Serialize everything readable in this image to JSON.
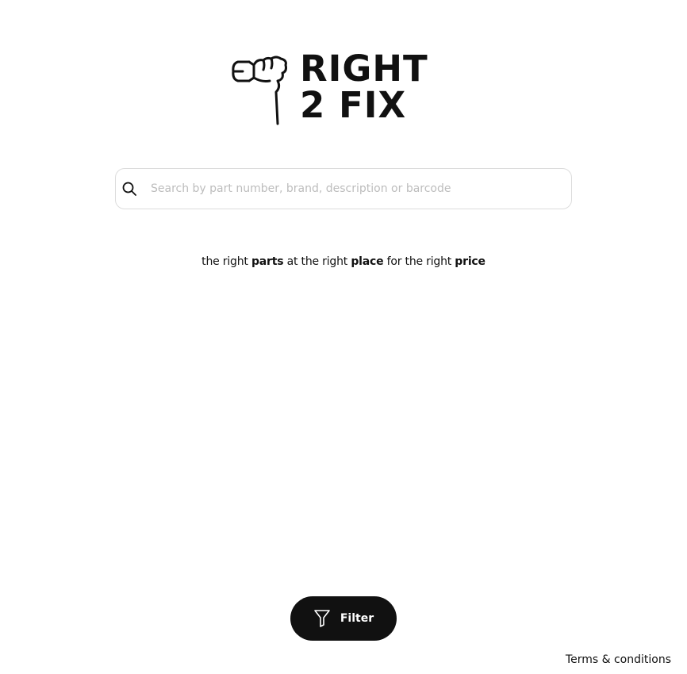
{
  "logo": {
    "line1": "RIGHT",
    "line2": "2 FIX",
    "mark_icon": "wrench-hand-icon"
  },
  "search": {
    "placeholder": "Search by part number, brand, description or barcode",
    "value": "",
    "icon": "search-icon"
  },
  "tagline": {
    "segments": [
      {
        "text": "the right ",
        "bold": false
      },
      {
        "text": "parts",
        "bold": true
      },
      {
        "text": " at the right ",
        "bold": false
      },
      {
        "text": "place",
        "bold": true
      },
      {
        "text": " for the right ",
        "bold": false
      },
      {
        "text": "price",
        "bold": true
      }
    ]
  },
  "filter_button": {
    "label": "Filter",
    "icon": "funnel-icon"
  },
  "footer": {
    "terms_label": "Terms & conditions"
  },
  "colors": {
    "text": "#111111",
    "button_bg": "#111111",
    "button_text": "#ffffff",
    "input_border": "#dcdcdc",
    "placeholder": "#bdbdbd"
  }
}
